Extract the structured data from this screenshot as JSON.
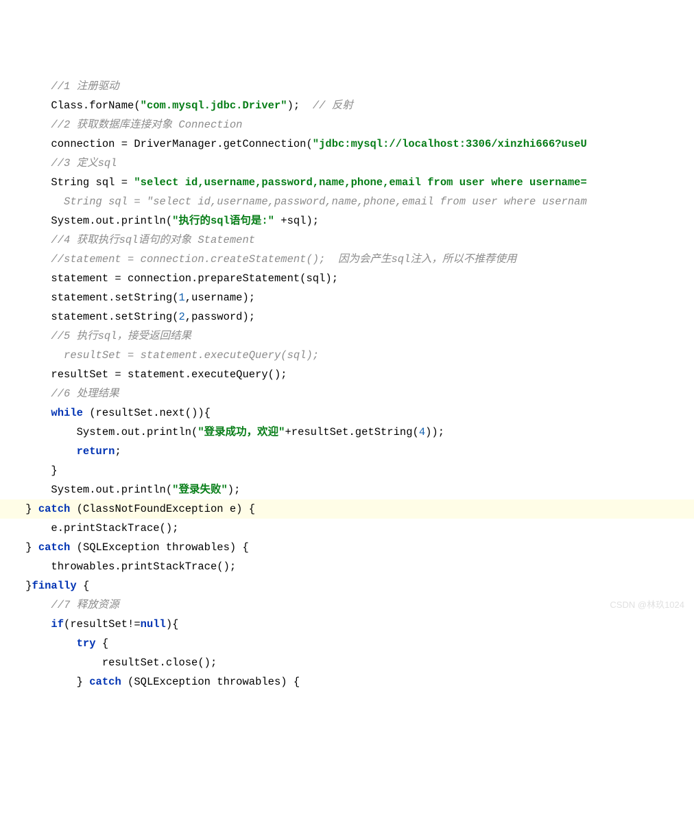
{
  "watermark": "CSDN @林玖1024",
  "lines": [
    {
      "indent": "        ",
      "tokens": [
        {
          "t": "cm",
          "v": "//1 注册驱动"
        }
      ]
    },
    {
      "indent": "        ",
      "tokens": [
        {
          "t": "plain",
          "v": "Class.forName("
        },
        {
          "t": "str",
          "v": "\"com.mysql.jdbc.Driver\""
        },
        {
          "t": "plain",
          "v": ");  "
        },
        {
          "t": "cm",
          "v": "// 反射"
        }
      ]
    },
    {
      "indent": "        ",
      "tokens": [
        {
          "t": "cm",
          "v": "//2 获取数据库连接对象 Connection"
        }
      ]
    },
    {
      "indent": "        ",
      "tokens": [
        {
          "t": "plain",
          "v": "connection = DriverManager.getConnection("
        },
        {
          "t": "str",
          "v": "\"jdbc:mysql://localhost:3306/xinzhi666?useU"
        }
      ]
    },
    {
      "indent": "        ",
      "tokens": [
        {
          "t": "cm",
          "v": "//3 定义sql"
        }
      ]
    },
    {
      "indent": "        ",
      "tokens": [
        {
          "t": "plain",
          "v": "String sql = "
        },
        {
          "t": "str",
          "v": "\"select id,username,password,name,phone,email from user where username="
        }
      ]
    },
    {
      "indent": "          ",
      "tokens": [
        {
          "t": "cm",
          "v": "String sql = \"select id,username,password,name,phone,email from user where usernam"
        }
      ]
    },
    {
      "indent": "        ",
      "tokens": [
        {
          "t": "plain",
          "v": "System.out.println("
        },
        {
          "t": "str",
          "v": "\"执行的sql语句是:\""
        },
        {
          "t": "plain",
          "v": " +sql);"
        }
      ]
    },
    {
      "indent": "        ",
      "tokens": [
        {
          "t": "cm",
          "v": "//4 获取执行sql语句的对象 Statement"
        }
      ]
    },
    {
      "indent": "        ",
      "tokens": [
        {
          "t": "cm",
          "v": "//statement = connection.createStatement();  因为会产生sql注入，所以不推荐使用"
        }
      ]
    },
    {
      "indent": "        ",
      "tokens": [
        {
          "t": "plain",
          "v": "statement = connection.prepareStatement(sql);"
        }
      ]
    },
    {
      "indent": "        ",
      "tokens": [
        {
          "t": "plain",
          "v": "statement.setString("
        },
        {
          "t": "num",
          "v": "1"
        },
        {
          "t": "plain",
          "v": ",username);"
        }
      ]
    },
    {
      "indent": "        ",
      "tokens": [
        {
          "t": "plain",
          "v": "statement.setString("
        },
        {
          "t": "num",
          "v": "2"
        },
        {
          "t": "plain",
          "v": ",password);"
        }
      ]
    },
    {
      "indent": "        ",
      "tokens": [
        {
          "t": "cm",
          "v": "//5 执行sql，接受返回结果"
        }
      ]
    },
    {
      "indent": "          ",
      "tokens": [
        {
          "t": "cm",
          "v": "resultSet = statement.executeQuery(sql);"
        }
      ]
    },
    {
      "indent": "        ",
      "tokens": [
        {
          "t": "plain",
          "v": "resultSet = statement.executeQuery();"
        }
      ]
    },
    {
      "indent": "        ",
      "tokens": [
        {
          "t": "cm",
          "v": "//6 处理结果"
        }
      ]
    },
    {
      "indent": "        ",
      "tokens": [
        {
          "t": "kw-bold",
          "v": "while"
        },
        {
          "t": "plain",
          "v": " (resultSet.next()){"
        }
      ]
    },
    {
      "indent": "            ",
      "tokens": [
        {
          "t": "plain",
          "v": "System.out.println("
        },
        {
          "t": "str",
          "v": "\"登录成功，欢迎\""
        },
        {
          "t": "plain",
          "v": "+resultSet.getString("
        },
        {
          "t": "num",
          "v": "4"
        },
        {
          "t": "plain",
          "v": "));"
        }
      ]
    },
    {
      "indent": "            ",
      "tokens": [
        {
          "t": "kw-bold",
          "v": "return"
        },
        {
          "t": "plain",
          "v": ";"
        }
      ]
    },
    {
      "indent": "        ",
      "tokens": [
        {
          "t": "plain",
          "v": "}"
        }
      ]
    },
    {
      "indent": "        ",
      "tokens": [
        {
          "t": "plain",
          "v": "System.out.println("
        },
        {
          "t": "str",
          "v": "\"登录失败\""
        },
        {
          "t": "plain",
          "v": ");"
        }
      ]
    },
    {
      "hl": true,
      "indent": "    ",
      "tokens": [
        {
          "t": "plain",
          "v": "} "
        },
        {
          "t": "kw-bold",
          "v": "catch"
        },
        {
          "t": "plain",
          "v": " (ClassNotFoundException e) {"
        }
      ]
    },
    {
      "indent": "        ",
      "tokens": [
        {
          "t": "plain",
          "v": "e.printStackTrace();"
        }
      ]
    },
    {
      "indent": "    ",
      "tokens": [
        {
          "t": "plain",
          "v": "} "
        },
        {
          "t": "kw-bold",
          "v": "catch"
        },
        {
          "t": "plain",
          "v": " (SQLException throwables) {"
        }
      ]
    },
    {
      "indent": "        ",
      "tokens": [
        {
          "t": "plain",
          "v": "throwables.printStackTrace();"
        }
      ]
    },
    {
      "indent": "    ",
      "tokens": [
        {
          "t": "plain",
          "v": "}"
        },
        {
          "t": "kw-bold",
          "v": "finally"
        },
        {
          "t": "plain",
          "v": " {"
        }
      ]
    },
    {
      "indent": "        ",
      "tokens": [
        {
          "t": "cm",
          "v": "//7 释放资源"
        }
      ]
    },
    {
      "indent": "        ",
      "tokens": [
        {
          "t": "kw-bold",
          "v": "if"
        },
        {
          "t": "plain",
          "v": "(resultSet!="
        },
        {
          "t": "kw-bold",
          "v": "null"
        },
        {
          "t": "plain",
          "v": "){"
        }
      ]
    },
    {
      "indent": "            ",
      "tokens": [
        {
          "t": "kw-bold",
          "v": "try"
        },
        {
          "t": "plain",
          "v": " {"
        }
      ]
    },
    {
      "indent": "                ",
      "tokens": [
        {
          "t": "plain",
          "v": "resultSet.close();"
        }
      ]
    },
    {
      "indent": "            ",
      "tokens": [
        {
          "t": "plain",
          "v": "} "
        },
        {
          "t": "kw-bold",
          "v": "catch"
        },
        {
          "t": "plain",
          "v": " (SQLException throwables) {"
        }
      ]
    }
  ]
}
